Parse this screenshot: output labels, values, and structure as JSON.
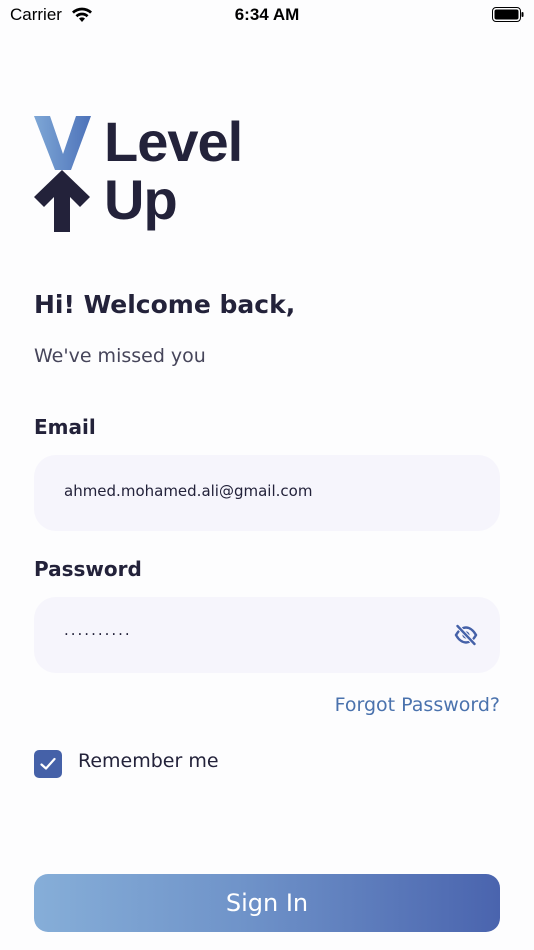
{
  "status_bar": {
    "carrier": "Carrier",
    "time": "6:34 AM",
    "wifi_icon": "wifi-icon",
    "battery_icon": "battery-icon"
  },
  "logo": {
    "line1": "Level",
    "line2": "Up",
    "icons": [
      "v-mark-icon",
      "up-arrow-icon"
    ],
    "colors": {
      "v_mark": "#5d86c4",
      "arrow": "#23223a",
      "text": "#23223a"
    }
  },
  "header": {
    "greeting": "Hi! Welcome back,",
    "subtitle": "We've missed you"
  },
  "form": {
    "email": {
      "label": "Email",
      "value": "ahmed.mohamed.ali@gmail.com"
    },
    "password": {
      "label": "Password",
      "value": "..........",
      "toggle_icon": "eye-off-icon"
    },
    "forgot_password": "Forgot Password?",
    "remember_me": {
      "label": "Remember me",
      "checked": true
    },
    "submit_label": "Sign In"
  },
  "colors": {
    "accent": "#4a72ad",
    "checkbox": "#4561a8",
    "button_gradient_start": "#86aed8",
    "button_gradient_end": "#4a64ae",
    "input_background": "#f6f5fc"
  }
}
